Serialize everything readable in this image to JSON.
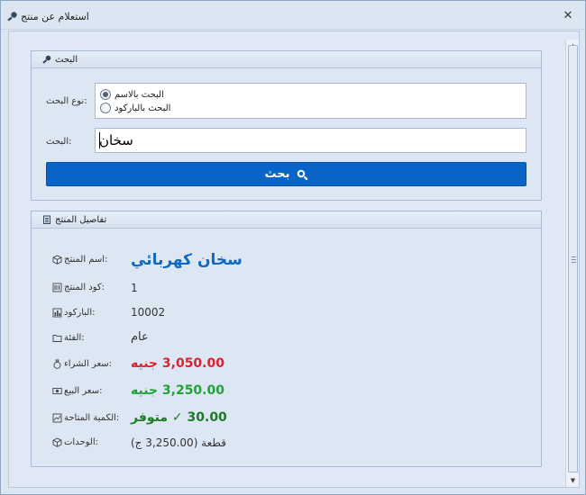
{
  "window": {
    "title": "استعلام عن منتج",
    "close_glyph": "✕"
  },
  "search_group": {
    "title": "البحث",
    "search_type_label": ":نوع البحث",
    "options": [
      {
        "label": "البحث بالاسم",
        "checked": true
      },
      {
        "label": "البحث بالباركود",
        "checked": false
      }
    ],
    "search_label": ":البحث",
    "search_value": "سخان",
    "button_label": "بحث",
    "button_color": "#0a64c8"
  },
  "details_group": {
    "title": "تفاصيل المنتج",
    "rows": [
      {
        "label": ":اسم المنتج",
        "value": "سخان كهربائي",
        "icon": "cube-icon"
      },
      {
        "label": ":كود المنتج",
        "value": "1",
        "icon": "barcode-icon"
      },
      {
        "label": ":الباركود",
        "value": "10002",
        "icon": "chart-icon"
      },
      {
        "label": ":الفئة",
        "value": "عام",
        "icon": "folder-icon"
      },
      {
        "label": ":سعر الشراء",
        "value": "3,050.00 جنيه",
        "icon": "money-bag-icon",
        "color": "#d9232e"
      },
      {
        "label": ":سعر البيع",
        "value": "3,250.00 جنيه",
        "icon": "cash-icon",
        "color": "#23a03a"
      },
      {
        "label": ":الكمية المتاحة",
        "value": "30.00 ✓ متوفر",
        "icon": "stock-chart-icon",
        "color": "#1e7a25"
      },
      {
        "label": ":الوحدات",
        "value": "قطعة (3,250.00 ج)",
        "icon": "box-icon"
      }
    ]
  },
  "scrollbar": {
    "up_glyph": "▲",
    "down_glyph": "▼"
  }
}
